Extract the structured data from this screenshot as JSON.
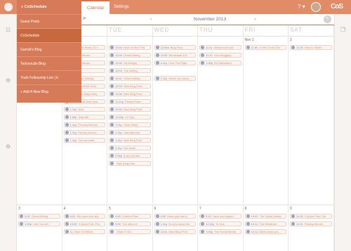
{
  "topbar": {
    "tabs": [
      "Calendar",
      "Settings"
    ],
    "help": "? ▾"
  },
  "brand": "CoS",
  "menu": {
    "title": "≡ CoSchedule",
    "items": [
      "Guest Posts",
      "CoSchedule",
      "Garrett's Blog",
      "Todoyoudo Blog",
      "Truth Fellowship Live | E",
      "+ Add A New Blog"
    ],
    "selected": 1
  },
  "calendar": {
    "month_label": "November 2013",
    "prev": "‹",
    "next": "›",
    "search_icon": "search-icon",
    "days": [
      "SUN",
      "MON",
      "TUE",
      "WED",
      "THU",
      "FRI",
      "SAT"
    ],
    "first_week_numbers": [
      "",
      "",
      "",
      "",
      "",
      "Nov 1",
      "2"
    ],
    "last_week_numbers": [
      "3",
      "4",
      "5",
      "6",
      "7",
      "8",
      "9"
    ]
  },
  "events": [
    {
      "time": "10:41",
      "title": "New Show 10-4"
    },
    {
      "time": "10:00",
      "title": "How To Run This"
    },
    {
      "time": "12:00a",
      "title": "Blog Post"
    },
    {
      "time": "11:01",
      "title": "What would you"
    },
    {
      "time": "11:00",
      "title": "It Feel Good Tim"
    },
    {
      "time": "11:00",
      "title": "How to Tackle"
    },
    {
      "time": "",
      "title": "Writing Heroes"
    },
    {
      "time": "10:00",
      "title": "Great Writing"
    },
    {
      "time": "10:00",
      "title": "Wholesale 101"
    },
    {
      "time": "11:10",
      "title": "Your Blogging"
    },
    {
      "time": "",
      "title": "Writing Heroes"
    },
    {
      "time": "12:00",
      "title": "I'm Hungry"
    },
    {
      "time": "2:11p",
      "title": "Find The Right"
    },
    {
      "time": "1:00p",
      "title": "It's Halloween"
    },
    {
      "time": "",
      "title": "Writing"
    },
    {
      "time": "10:03",
      "title": "The writing"
    },
    {
      "time": "10:41",
      "title": "Great Writing"
    },
    {
      "time": "2:11p",
      "title": "Worth You know"
    },
    {
      "time": "10:41",
      "title": "How Writing"
    },
    {
      "time": "10:03",
      "title": "New Blog Post"
    },
    {
      "time": "10:41",
      "title": "What the Hold"
    },
    {
      "time": "10:41",
      "title": "The Easy Easy"
    },
    {
      "time": "11:41",
      "title": "Great New Year"
    },
    {
      "time": "10:00",
      "title": "New Blog Post"
    },
    {
      "time": "12:11p",
      "title": "Please Enter"
    },
    {
      "time": "10:00",
      "title": "New Blog Post"
    },
    {
      "time": "1:11p",
      "title": "New"
    },
    {
      "time": "12:02p",
      "title": "10 Tips"
    },
    {
      "time": "1:00p",
      "title": "Help Me"
    },
    {
      "time": "1:11p",
      "title": "Case Study"
    },
    {
      "time": "1:11p",
      "title": "Proving Heroes"
    },
    {
      "time": "1:11p",
      "title": "Just wait and"
    },
    {
      "time": "1:11p",
      "title": "Pricing Heroes"
    },
    {
      "time": "1:11p",
      "title": "Can we write"
    },
    {
      "time": "1:11p",
      "title": "New Blog Post"
    },
    {
      "time": "2:11p",
      "title": "Our week"
    },
    {
      "time": "2:05p",
      "title": "Even Heroes"
    },
    {
      "time": "",
      "title": "New Blog Post"
    },
    {
      "time": "9:00",
      "title": "Great Writing"
    },
    {
      "time": "9:41",
      "title": "We have new fea"
    },
    {
      "time": "9:00",
      "title": "Content Plan"
    },
    {
      "time": "9:00",
      "title": "Have you had a"
    },
    {
      "time": "9:10",
      "title": "Have you signed"
    },
    {
      "time": "10:41",
      "title": "The Social Media"
    },
    {
      "time": "11:00",
      "title": "3 Quick Free Tim"
    },
    {
      "time": "1:00p",
      "title": "Can You sell"
    },
    {
      "time": "10:00",
      "title": "3 Quick Free Tim"
    },
    {
      "time": "9:00",
      "title": "The other st"
    },
    {
      "time": "12:11",
      "title": "The Whatever"
    },
    {
      "time": "11:41",
      "title": "Pricing Heroes"
    },
    {
      "time": "11",
      "title": "How To Deliver"
    },
    {
      "time": "",
      "title": "What To Do"
    },
    {
      "time": "10:41",
      "title": "New Blog Post"
    },
    {
      "time": "12:11",
      "title": "What could you"
    },
    {
      "time": "12:41p",
      "title": "To Dos"
    },
    {
      "time": "1:11p",
      "title": "Do you know the"
    },
    {
      "time": "1:00p",
      "title": "The Social Media"
    }
  ]
}
